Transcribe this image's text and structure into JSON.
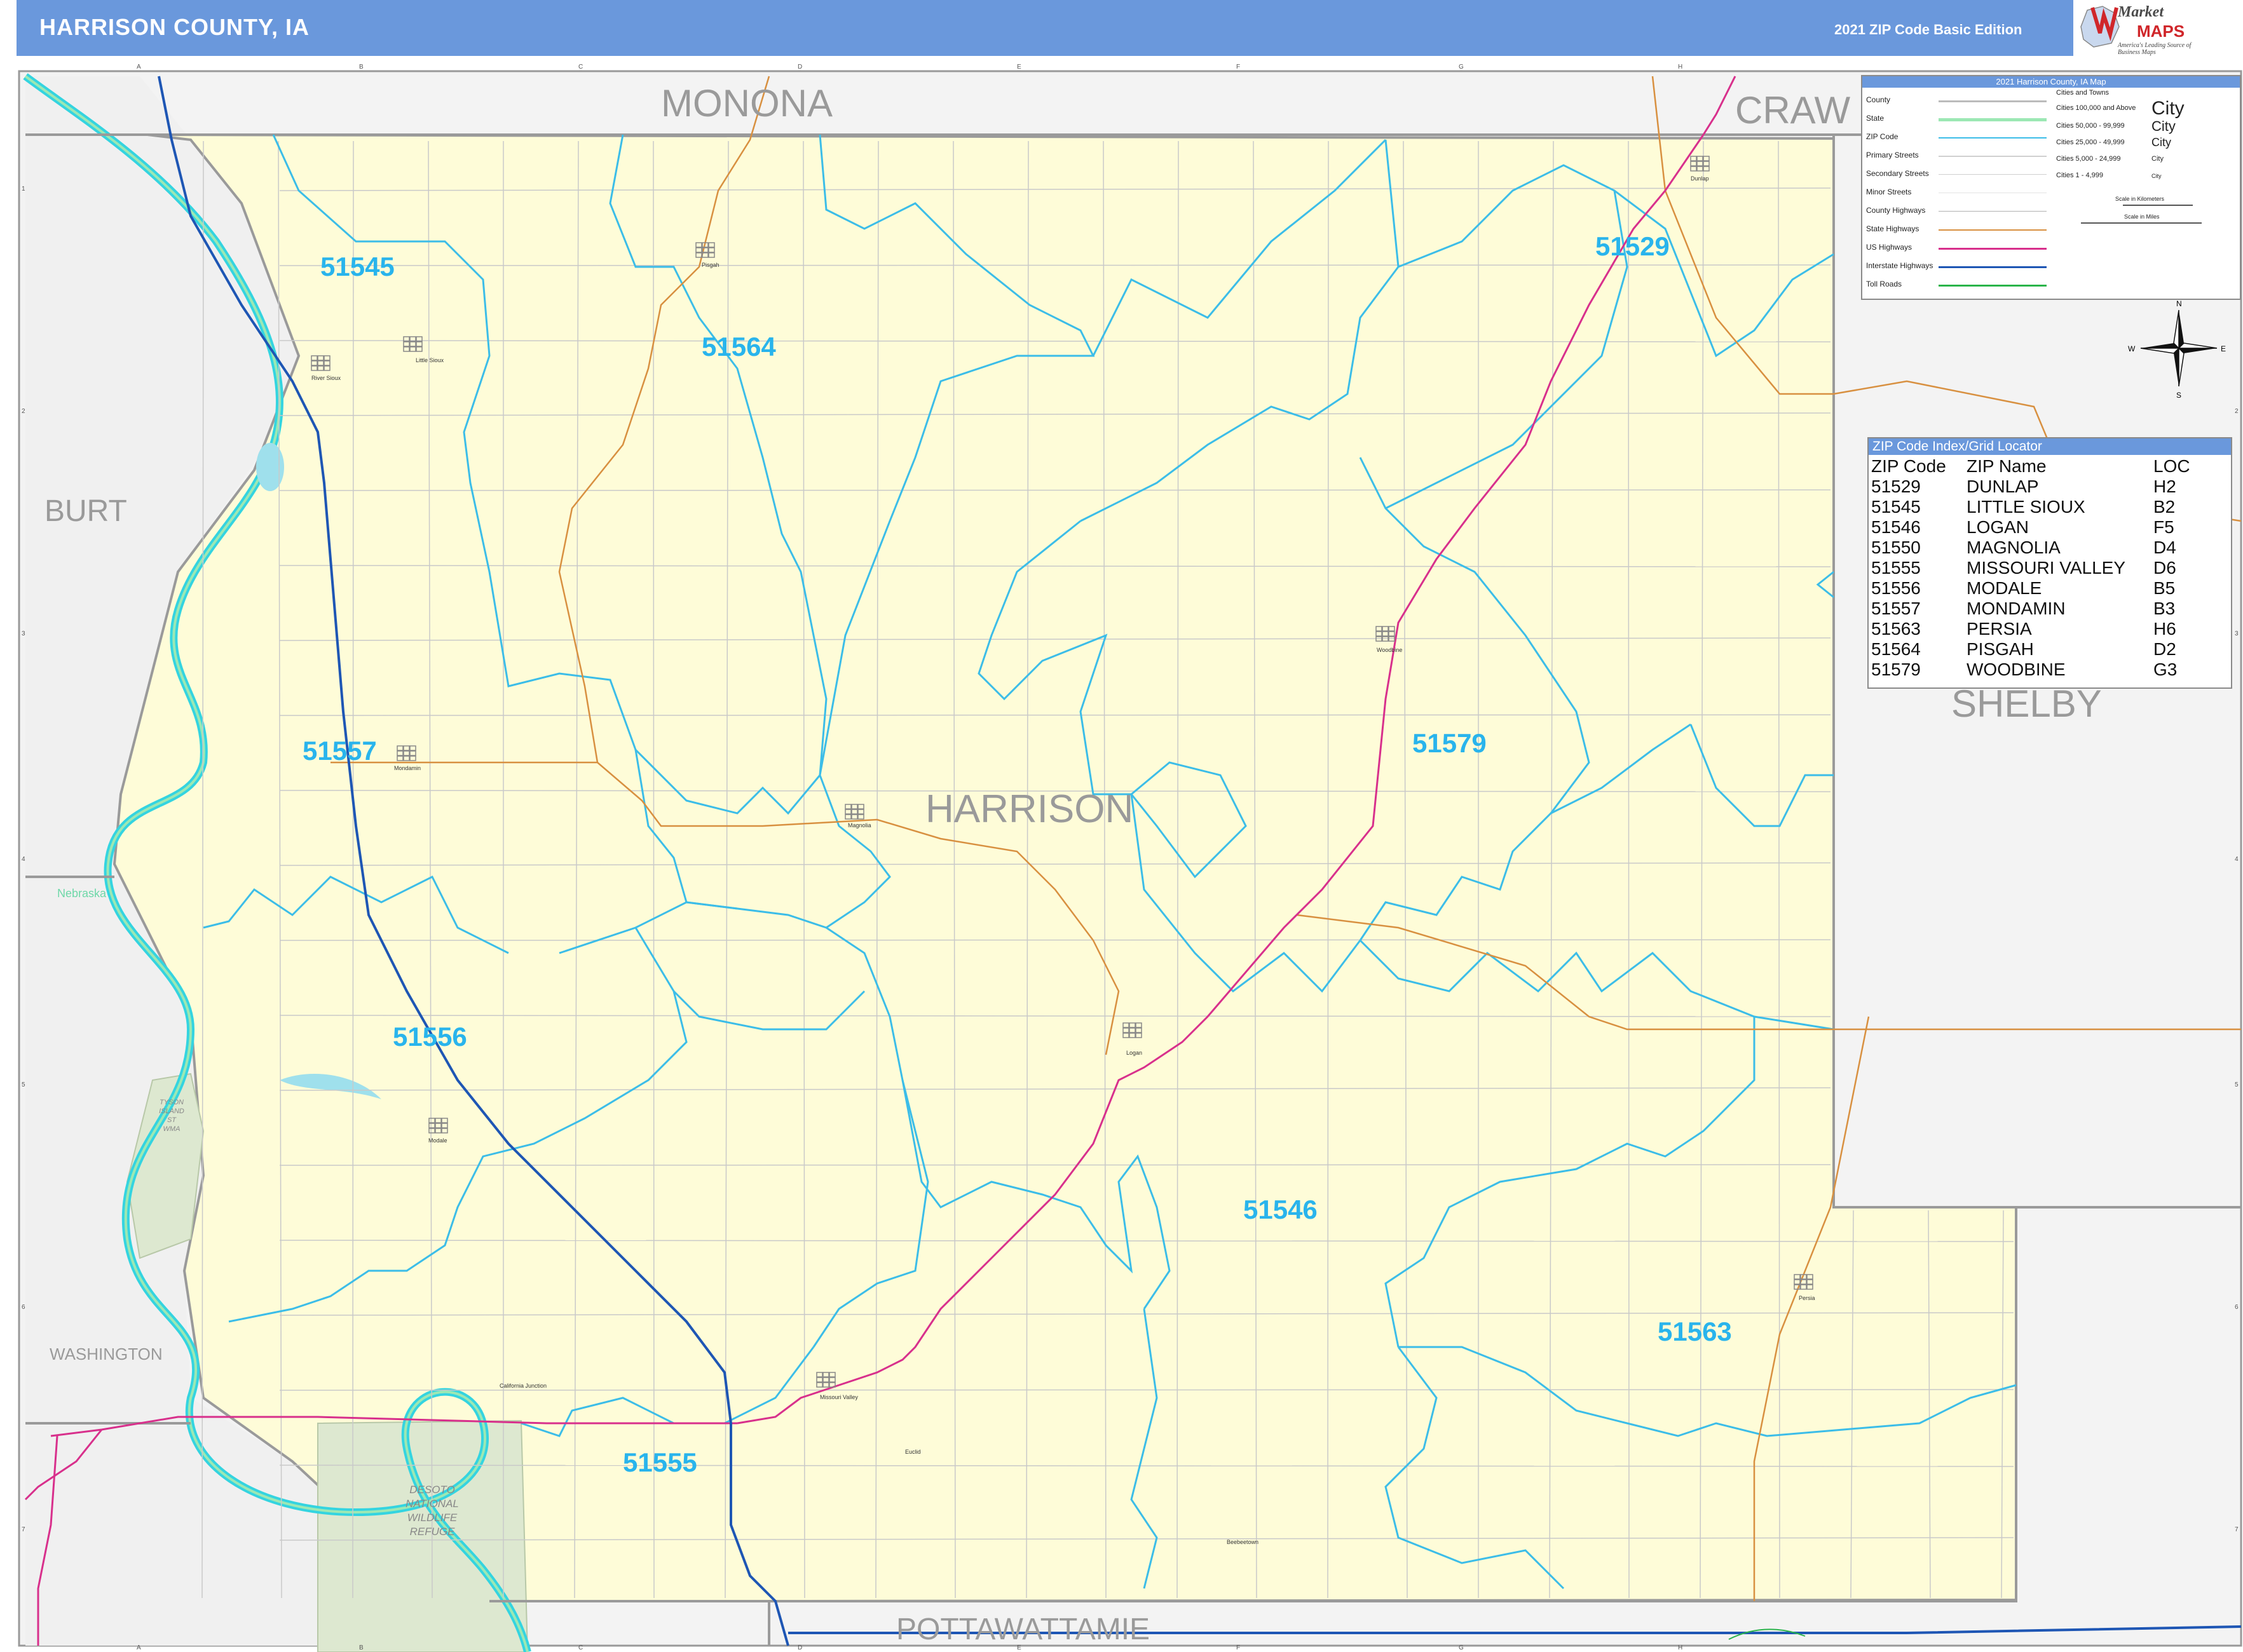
{
  "header": {
    "title": "HARRISON COUNTY, IA",
    "edition": "2021 ZIP Code Basic Edition"
  },
  "logo": {
    "market": "Market",
    "maps": "MAPS",
    "tagline": "America's Leading Source of Business Maps"
  },
  "colors": {
    "header": "#6a98dc",
    "county_fill": "#fefcd8",
    "outside_fill": "#f3f3f3",
    "zip_boundary": "#3cbde8",
    "county_boundary": "#9a9a9a",
    "state_boundary": "#9ce8b4",
    "river": "#34d4e0",
    "us_highway": "#d8308c",
    "state_highway": "#d89040",
    "interstate": "#1e56b4",
    "zip_label": "#29b4ec",
    "wildlife_refuge": "#dde8d0"
  },
  "map": {
    "county_name": "HARRISON",
    "neighbors": [
      {
        "id": "monona",
        "name": "MONONA"
      },
      {
        "id": "crawford",
        "name": "CRAW"
      },
      {
        "id": "burt",
        "name": "BURT"
      },
      {
        "id": "shelby",
        "name": "SHELBY"
      },
      {
        "id": "washington",
        "name": "WASHINGTON"
      },
      {
        "id": "pottawattamie",
        "name": "POTTAWATTAMIE"
      }
    ],
    "state_label": "Nebraska",
    "refuge_lines": [
      "DESOTO",
      "NATIONAL",
      "WILDLIFE",
      "REFUGE"
    ],
    "wma_lines": [
      "TYSON",
      "ISLAND",
      "ST",
      "WMA"
    ],
    "grid_columns": [
      "A",
      "B",
      "C",
      "D",
      "E",
      "F",
      "G",
      "H"
    ],
    "grid_rows": [
      "1",
      "2",
      "3",
      "4",
      "5",
      "6",
      "7"
    ],
    "zip_labels": [
      {
        "zip": "51545"
      },
      {
        "zip": "51564"
      },
      {
        "zip": "51529"
      },
      {
        "zip": "51557"
      },
      {
        "zip": "51579"
      },
      {
        "zip": "51556"
      },
      {
        "zip": "51546"
      },
      {
        "zip": "51563"
      },
      {
        "zip": "51555"
      }
    ],
    "towns": [
      {
        "name": "Little Sioux"
      },
      {
        "name": "River Sioux"
      },
      {
        "name": "Pisgah"
      },
      {
        "name": "Dunlap"
      },
      {
        "name": "Woodbine"
      },
      {
        "name": "Mondamin"
      },
      {
        "name": "Magnolia"
      },
      {
        "name": "Logan"
      },
      {
        "name": "Modale"
      },
      {
        "name": "Persia"
      },
      {
        "name": "California Junction"
      },
      {
        "name": "Missouri Valley"
      },
      {
        "name": "Beebeetown"
      },
      {
        "name": "Euclid"
      }
    ]
  },
  "legend": {
    "title": "2021 Harrison County, IA Map",
    "items": [
      {
        "label": "County"
      },
      {
        "label": "State"
      },
      {
        "label": "ZIP Code"
      },
      {
        "label": "Primary Streets"
      },
      {
        "label": "Secondary Streets"
      },
      {
        "label": "Minor Streets"
      },
      {
        "label": "County Highways"
      },
      {
        "label": "State Highways"
      },
      {
        "label": "US Highways"
      },
      {
        "label": "Interstate Highways"
      },
      {
        "label": "Toll Roads"
      }
    ],
    "cities_title": "Cities and Towns",
    "cities": [
      {
        "range": "Cities 100,000 and Above",
        "sample": "City"
      },
      {
        "range": "Cities 50,000 - 99,999",
        "sample": "City"
      },
      {
        "range": "Cities 25,000 - 49,999",
        "sample": "City"
      },
      {
        "range": "Cities 5,000 - 24,999",
        "sample": "City"
      },
      {
        "range": "Cities 1 - 4,999",
        "sample": "City"
      }
    ],
    "scale_km": "Scale in Kilometers",
    "scale_miles": "Scale in Miles"
  },
  "compass": {
    "n": "N",
    "s": "S",
    "e": "E",
    "w": "W"
  },
  "zip_index": {
    "title": "ZIP Code Index/Grid Locator",
    "headers": [
      "ZIP Code",
      "ZIP Name",
      "LOC"
    ],
    "rows": [
      [
        "51529",
        "DUNLAP",
        "H2"
      ],
      [
        "51545",
        "LITTLE SIOUX",
        "B2"
      ],
      [
        "51546",
        "LOGAN",
        "F5"
      ],
      [
        "51550",
        "MAGNOLIA",
        "D4"
      ],
      [
        "51555",
        "MISSOURI VALLEY",
        "D6"
      ],
      [
        "51556",
        "MODALE",
        "B5"
      ],
      [
        "51557",
        "MONDAMIN",
        "B3"
      ],
      [
        "51563",
        "PERSIA",
        "H6"
      ],
      [
        "51564",
        "PISGAH",
        "D2"
      ],
      [
        "51579",
        "WOODBINE",
        "G3"
      ]
    ]
  }
}
